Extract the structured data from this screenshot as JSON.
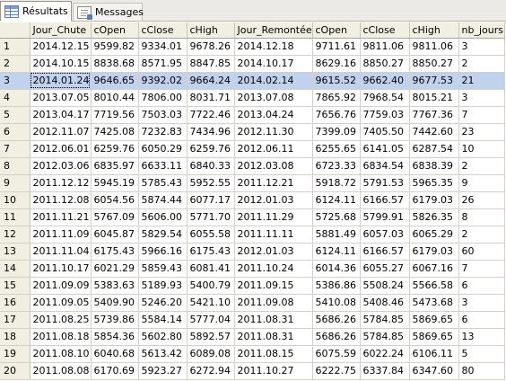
{
  "tabs": [
    {
      "label": "Résultats",
      "icon": "grid-icon",
      "active": true
    },
    {
      "label": "Messages",
      "icon": "messages-icon",
      "active": false
    }
  ],
  "grid": {
    "columns": [
      "",
      "Jour_Chute",
      "cOpen",
      "cClose",
      "cHigh",
      "Jour_Remontée",
      "cOpen",
      "cClose",
      "cHigh",
      "nb_jours"
    ],
    "selected_row": 3,
    "rows": [
      [
        "1",
        "2014.12.15",
        "9599.82",
        "9334.01",
        "9678.26",
        "2014.12.18",
        "9711.61",
        "9811.06",
        "9811.06",
        "3"
      ],
      [
        "2",
        "2014.10.15",
        "8838.68",
        "8571.95",
        "8847.85",
        "2014.10.17",
        "8629.16",
        "8850.27",
        "8850.27",
        "2"
      ],
      [
        "3",
        "2014.01.24",
        "9646.65",
        "9392.02",
        "9664.24",
        "2014.02.14",
        "9615.52",
        "9662.40",
        "9677.53",
        "21"
      ],
      [
        "4",
        "2013.07.05",
        "8010.44",
        "7806.00",
        "8031.71",
        "2013.07.08",
        "7865.92",
        "7968.54",
        "8015.21",
        "3"
      ],
      [
        "5",
        "2013.04.17",
        "7719.56",
        "7503.03",
        "7722.46",
        "2013.04.24",
        "7656.76",
        "7759.03",
        "7767.36",
        "7"
      ],
      [
        "6",
        "2012.11.07",
        "7425.08",
        "7232.83",
        "7434.96",
        "2012.11.30",
        "7399.09",
        "7405.50",
        "7442.60",
        "23"
      ],
      [
        "7",
        "2012.06.01",
        "6259.76",
        "6050.29",
        "6259.76",
        "2012.06.11",
        "6255.65",
        "6141.05",
        "6287.54",
        "10"
      ],
      [
        "8",
        "2012.03.06",
        "6835.97",
        "6633.11",
        "6840.33",
        "2012.03.08",
        "6723.33",
        "6834.54",
        "6838.39",
        "2"
      ],
      [
        "9",
        "2011.12.12",
        "5945.19",
        "5785.43",
        "5952.55",
        "2011.12.21",
        "5918.72",
        "5791.53",
        "5965.35",
        "9"
      ],
      [
        "10",
        "2011.12.08",
        "6054.56",
        "5874.44",
        "6077.17",
        "2012.01.03",
        "6124.11",
        "6166.57",
        "6179.03",
        "26"
      ],
      [
        "11",
        "2011.11.21",
        "5767.09",
        "5606.00",
        "5771.70",
        "2011.11.29",
        "5725.68",
        "5799.91",
        "5826.35",
        "8"
      ],
      [
        "12",
        "2011.11.09",
        "6045.87",
        "5829.54",
        "6055.58",
        "2011.11.11",
        "5881.49",
        "6057.03",
        "6065.29",
        "2"
      ],
      [
        "13",
        "2011.11.04",
        "6175.43",
        "5966.16",
        "6175.43",
        "2012.01.03",
        "6124.11",
        "6166.57",
        "6179.03",
        "60"
      ],
      [
        "14",
        "2011.10.17",
        "6021.29",
        "5859.43",
        "6081.41",
        "2011.10.24",
        "6014.36",
        "6055.27",
        "6067.16",
        "7"
      ],
      [
        "15",
        "2011.09.09",
        "5383.63",
        "5189.93",
        "5400.79",
        "2011.09.15",
        "5386.86",
        "5508.24",
        "5566.58",
        "6"
      ],
      [
        "16",
        "2011.09.05",
        "5409.90",
        "5246.20",
        "5421.10",
        "2011.09.08",
        "5410.08",
        "5408.46",
        "5473.68",
        "3"
      ],
      [
        "17",
        "2011.08.25",
        "5739.86",
        "5584.14",
        "5777.04",
        "2011.08.31",
        "5686.26",
        "5784.85",
        "5869.65",
        "6"
      ],
      [
        "18",
        "2011.08.18",
        "5854.36",
        "5602.80",
        "5892.57",
        "2011.08.31",
        "5686.26",
        "5784.85",
        "5869.65",
        "13"
      ],
      [
        "19",
        "2011.08.10",
        "6040.68",
        "5613.42",
        "6089.08",
        "2011.08.15",
        "6075.59",
        "6022.24",
        "6106.11",
        "5"
      ],
      [
        "20",
        "2011.08.08",
        "6170.69",
        "5923.27",
        "6272.94",
        "2011.10.27",
        "6222.75",
        "6337.84",
        "6347.60",
        "80"
      ]
    ]
  }
}
